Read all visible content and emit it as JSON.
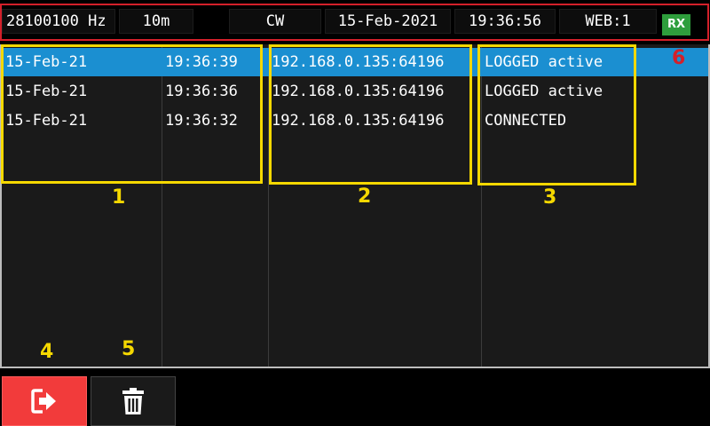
{
  "status_bar": {
    "frequency": "28100100 Hz",
    "band": "10m",
    "mode": "CW",
    "date": "15-Feb-2021",
    "time": "19:36:56",
    "web": "WEB:1",
    "rx": "RX"
  },
  "colors": {
    "selected_row": "#1b8fd1",
    "exit_button": "#f23b3b",
    "rx_badge": "#2e9e3c",
    "annotation_yellow": "#f5d800",
    "annotation_red": "#d4202a"
  },
  "log_rows": [
    {
      "date": "15-Feb-21",
      "time": "19:36:39",
      "address": "192.168.0.135:64196",
      "status": "LOGGED active",
      "selected": true
    },
    {
      "date": "15-Feb-21",
      "time": "19:36:36",
      "address": "192.168.0.135:64196",
      "status": "LOGGED active",
      "selected": false
    },
    {
      "date": "15-Feb-21",
      "time": "19:36:32",
      "address": "192.168.0.135:64196",
      "status": "CONNECTED",
      "selected": false
    }
  ],
  "buttons": {
    "exit_icon": "sign-out-icon",
    "delete_icon": "trash-icon"
  },
  "annotations": {
    "n1": "1",
    "n2": "2",
    "n3": "3",
    "n4": "4",
    "n5": "5",
    "n6": "6"
  }
}
